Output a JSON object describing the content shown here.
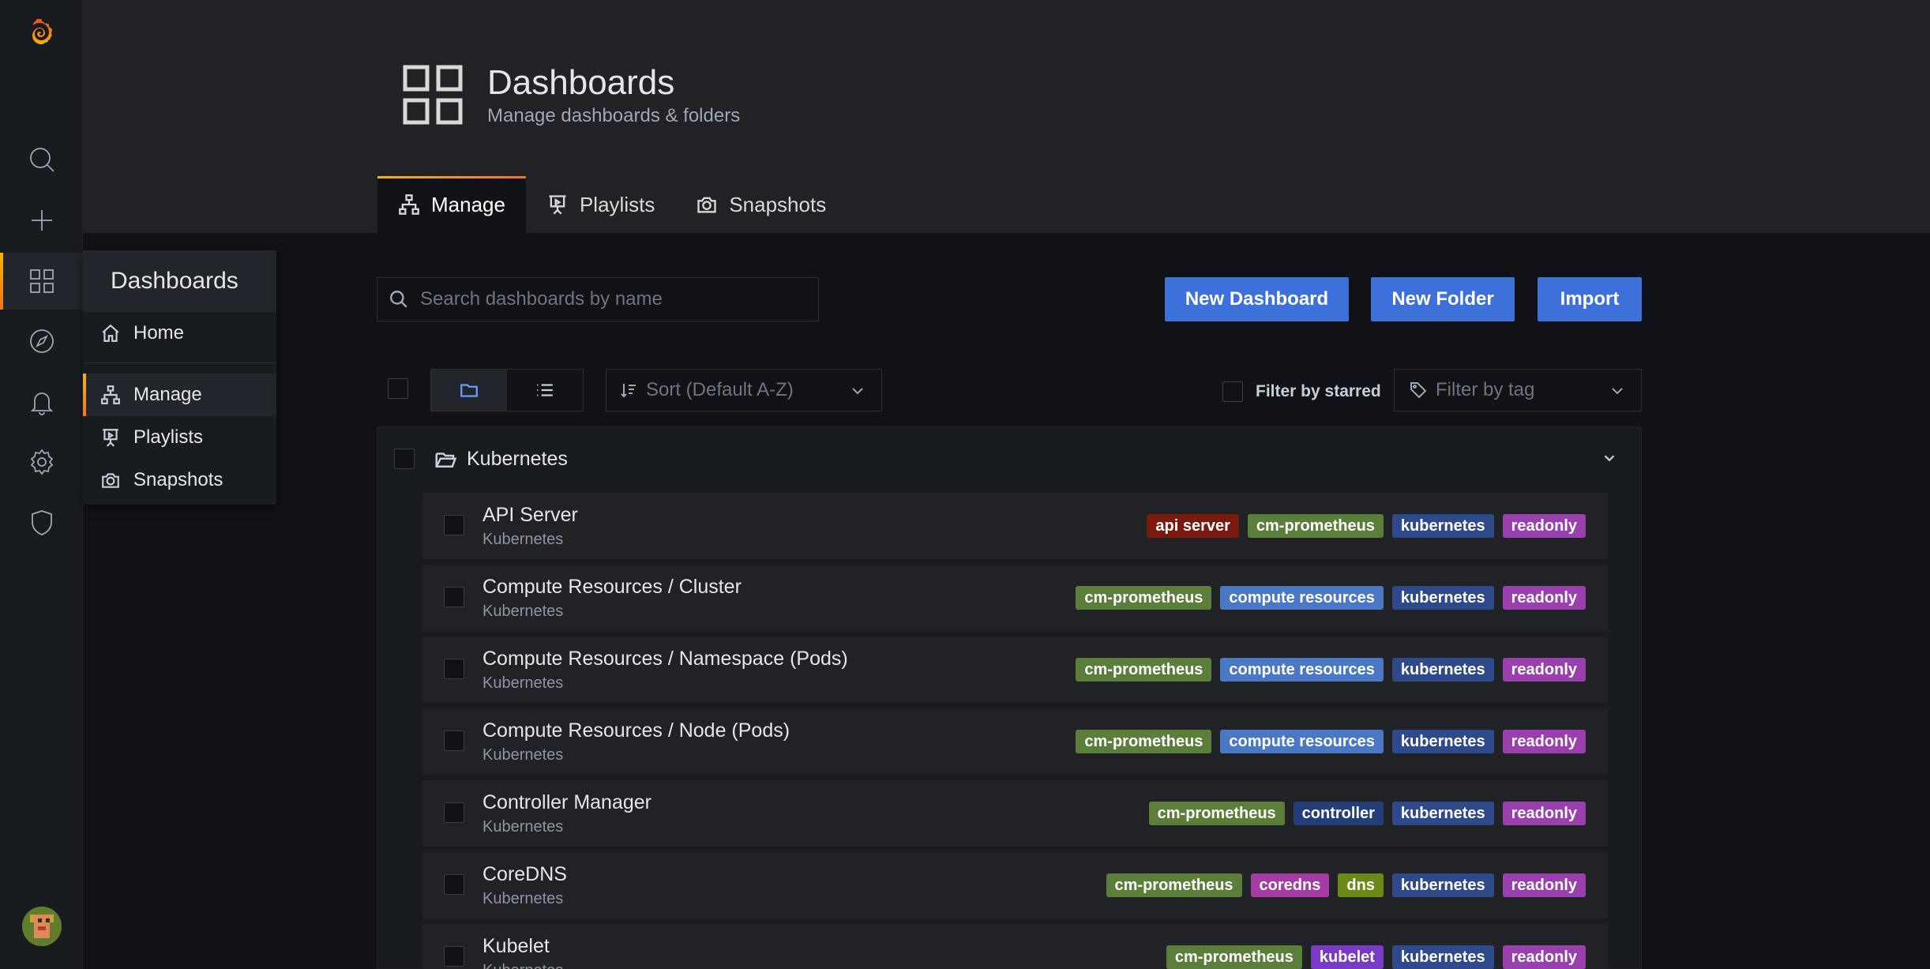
{
  "header": {
    "title": "Dashboards",
    "subtitle": "Manage dashboards & folders",
    "icon": "dashboards-grid-icon"
  },
  "sidebar": {
    "icons": [
      "grafana-logo-icon",
      "search-icon",
      "plus-icon",
      "dashboards-icon",
      "explore-compass-icon",
      "alerting-bell-icon",
      "gear-icon",
      "shield-icon"
    ],
    "active": "dashboards-icon"
  },
  "flyout": {
    "title": "Dashboards",
    "items": [
      {
        "label": "Home",
        "icon": "home-icon"
      },
      {
        "label": "Manage",
        "icon": "sitemap-icon",
        "active": true
      },
      {
        "label": "Playlists",
        "icon": "presentation-icon"
      },
      {
        "label": "Snapshots",
        "icon": "camera-icon"
      }
    ]
  },
  "tabs": [
    {
      "label": "Manage",
      "icon": "sitemap-icon",
      "active": true
    },
    {
      "label": "Playlists",
      "icon": "presentation-icon"
    },
    {
      "label": "Snapshots",
      "icon": "camera-icon"
    }
  ],
  "toolbar": {
    "search_placeholder": "Search dashboards by name",
    "new_dashboard": "New Dashboard",
    "new_folder": "New Folder",
    "import": "Import",
    "sort_placeholder": "Sort (Default A-Z)",
    "filter_starred": "Filter by starred",
    "filter_tag_placeholder": "Filter by tag"
  },
  "colors": {
    "primary_button": "#3d71d9",
    "accent_gradient": [
      "#f7b500",
      "#f4731c"
    ],
    "tag_api_server": "#7a1a0f",
    "tag_cm_prometheus": "#5b7e3a",
    "tag_compute_resources": "#4a78c4",
    "tag_kubernetes": "#2f4a8a",
    "tag_readonly": "#9a3fae",
    "tag_controller": "#243e78",
    "tag_coredns": "#a53ca3",
    "tag_dns": "#6b8a17",
    "tag_kubelet": "#7a3bc4"
  },
  "folder": {
    "name": "Kubernetes",
    "dashboards": [
      {
        "title": "API Server",
        "folder": "Kubernetes",
        "tags": [
          {
            "label": "api server",
            "color": "#7a1a0f"
          },
          {
            "label": "cm-prometheus",
            "color": "#5b7e3a"
          },
          {
            "label": "kubernetes",
            "color": "#2f4a8a"
          },
          {
            "label": "readonly",
            "color": "#9a3fae"
          }
        ]
      },
      {
        "title": "Compute Resources / Cluster",
        "folder": "Kubernetes",
        "tags": [
          {
            "label": "cm-prometheus",
            "color": "#5b7e3a"
          },
          {
            "label": "compute resources",
            "color": "#4a78c4"
          },
          {
            "label": "kubernetes",
            "color": "#2f4a8a"
          },
          {
            "label": "readonly",
            "color": "#9a3fae"
          }
        ]
      },
      {
        "title": "Compute Resources / Namespace (Pods)",
        "folder": "Kubernetes",
        "tags": [
          {
            "label": "cm-prometheus",
            "color": "#5b7e3a"
          },
          {
            "label": "compute resources",
            "color": "#4a78c4"
          },
          {
            "label": "kubernetes",
            "color": "#2f4a8a"
          },
          {
            "label": "readonly",
            "color": "#9a3fae"
          }
        ]
      },
      {
        "title": "Compute Resources / Node (Pods)",
        "folder": "Kubernetes",
        "tags": [
          {
            "label": "cm-prometheus",
            "color": "#5b7e3a"
          },
          {
            "label": "compute resources",
            "color": "#4a78c4"
          },
          {
            "label": "kubernetes",
            "color": "#2f4a8a"
          },
          {
            "label": "readonly",
            "color": "#9a3fae"
          }
        ]
      },
      {
        "title": "Controller Manager",
        "folder": "Kubernetes",
        "tags": [
          {
            "label": "cm-prometheus",
            "color": "#5b7e3a"
          },
          {
            "label": "controller",
            "color": "#243e78"
          },
          {
            "label": "kubernetes",
            "color": "#2f4a8a"
          },
          {
            "label": "readonly",
            "color": "#9a3fae"
          }
        ]
      },
      {
        "title": "CoreDNS",
        "folder": "Kubernetes",
        "tags": [
          {
            "label": "cm-prometheus",
            "color": "#5b7e3a"
          },
          {
            "label": "coredns",
            "color": "#a53ca3"
          },
          {
            "label": "dns",
            "color": "#6b8a17"
          },
          {
            "label": "kubernetes",
            "color": "#2f4a8a"
          },
          {
            "label": "readonly",
            "color": "#9a3fae"
          }
        ]
      },
      {
        "title": "Kubelet",
        "folder": "Kubernetes",
        "tags": [
          {
            "label": "cm-prometheus",
            "color": "#5b7e3a"
          },
          {
            "label": "kubelet",
            "color": "#7a3bc4"
          },
          {
            "label": "kubernetes",
            "color": "#2f4a8a"
          },
          {
            "label": "readonly",
            "color": "#9a3fae"
          }
        ]
      }
    ]
  }
}
